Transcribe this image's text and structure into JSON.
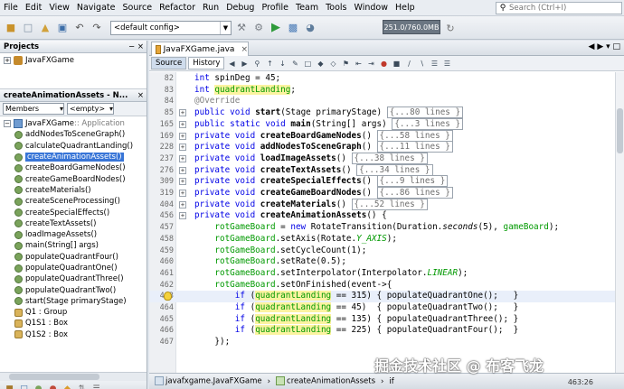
{
  "menu": [
    "File",
    "Edit",
    "View",
    "Navigate",
    "Source",
    "Refactor",
    "Run",
    "Debug",
    "Profile",
    "Team",
    "Tools",
    "Window",
    "Help"
  ],
  "search": {
    "placeholder": "Search (Ctrl+I)"
  },
  "toolbar": {
    "config": "<default config>",
    "memory": "251.0/760.0MB"
  },
  "projects": {
    "title": "Projects",
    "root": "JavaFXGame"
  },
  "navigator": {
    "title": "createAnimationAssets - N...",
    "filter": "Members",
    "filter2": "<empty>",
    "root_name": "JavaFXGame",
    "root_type": " :: Application",
    "items": [
      {
        "name": "addNodesToSceneGraph()",
        "kind": "method"
      },
      {
        "name": "calculateQuadrantLanding()",
        "kind": "method"
      },
      {
        "name": "createAnimationAssets()",
        "kind": "method",
        "selected": true
      },
      {
        "name": "createBoardGameNodes()",
        "kind": "method"
      },
      {
        "name": "createGameBoardNodes()",
        "kind": "method"
      },
      {
        "name": "createMaterials()",
        "kind": "method"
      },
      {
        "name": "createSceneProcessing()",
        "kind": "method"
      },
      {
        "name": "createSpecialEffects()",
        "kind": "method"
      },
      {
        "name": "createTextAssets()",
        "kind": "method"
      },
      {
        "name": "loadImageAssets()",
        "kind": "method"
      },
      {
        "name": "main(String[] args)",
        "kind": "method"
      },
      {
        "name": "populateQuadrantFour()",
        "kind": "method"
      },
      {
        "name": "populateQuadrantOne()",
        "kind": "method"
      },
      {
        "name": "populateQuadrantThree()",
        "kind": "method"
      },
      {
        "name": "populateQuadrantTwo()",
        "kind": "method"
      },
      {
        "name": "start(Stage primaryStage)",
        "kind": "method"
      },
      {
        "name": "Q1 : Group",
        "kind": "field"
      },
      {
        "name": "Q1S1 : Box",
        "kind": "field"
      },
      {
        "name": "Q1S2 : Box",
        "kind": "field"
      }
    ]
  },
  "editor": {
    "tab": "JavaFXGame.java",
    "source_btn": "Source",
    "history_btn": "History"
  },
  "code": [
    {
      "ln": "82",
      "html": "<span class=\"kw\">int</span> spinDeg = 45;"
    },
    {
      "ln": "83",
      "html": "<span class=\"kw\">int</span> <span class=\"hl\">quadrantLanding</span>;"
    },
    {
      "ln": "84",
      "html": "<span class=\"ann\">@Override</span>"
    },
    {
      "ln": "85",
      "fold": true,
      "html": "<span class=\"kw\">public void</span> <span class=\"bold\">start</span>(Stage primaryStage) <span class=\"fold-box\">{...80 lines }</span>"
    },
    {
      "ln": "165",
      "fold": true,
      "html": "<span class=\"kw\">public static void</span> <span class=\"bold\">main</span>(String[] args) <span class=\"fold-box\">{...3 lines }</span>"
    },
    {
      "ln": "169",
      "fold": true,
      "html": "<span class=\"kw\">private void</span> <span class=\"bold\">createBoardGameNodes</span>() <span class=\"fold-box\">{...58 lines }</span>"
    },
    {
      "ln": "228",
      "fold": true,
      "html": "<span class=\"kw\">private void</span> <span class=\"bold\">addNodesToSceneGraph</span>() <span class=\"fold-box\">{...11 lines }</span>"
    },
    {
      "ln": "237",
      "fold": true,
      "html": "<span class=\"kw\">private void</span> <span class=\"bold\">loadImageAssets</span>() <span class=\"fold-box\">{...38 lines }</span>"
    },
    {
      "ln": "276",
      "fold": true,
      "html": "<span class=\"kw\">private void</span> <span class=\"bold\">createTextAssets</span>() <span class=\"fold-box\">{...34 lines }</span>"
    },
    {
      "ln": "309",
      "fold": true,
      "html": "<span class=\"kw\">private void</span> <span class=\"bold\">createSpecialEffects</span>() <span class=\"fold-box\">{...9 lines }</span>"
    },
    {
      "ln": "319",
      "fold": true,
      "html": "<span class=\"kw\">private void</span> <span class=\"bold\">createGameBoardNodes</span>() <span class=\"fold-box\">{...86 lines }</span>"
    },
    {
      "ln": "404",
      "fold": true,
      "html": "<span class=\"kw\">private void</span> <span class=\"bold\">createMaterials</span>() <span class=\"fold-box\">{...52 lines }</span>"
    },
    {
      "ln": "456",
      "fold": true,
      "html": "<span class=\"kw\">private void</span> <span class=\"bold\">createAnimationAssets</span>() {"
    },
    {
      "ln": "457",
      "html": "    <span class=\"fld\">rotGameBoard</span> = <span class=\"kw\">new</span> RotateTransition(Duration.<span class=\"ital\">seconds</span>(5), <span class=\"fld\">gameBoard</span>);"
    },
    {
      "ln": "458",
      "html": "    <span class=\"fld\">rotGameBoard</span>.setAxis(Rotate.<span class=\"ital fld\">Y_AXIS</span>);"
    },
    {
      "ln": "459",
      "html": "    <span class=\"fld\">rotGameBoard</span>.setCycleCount(1);"
    },
    {
      "ln": "460",
      "html": "    <span class=\"fld\">rotGameBoard</span>.setRate(0.5);"
    },
    {
      "ln": "461",
      "html": "    <span class=\"fld\">rotGameBoard</span>.setInterpolator(Interpolator.<span class=\"ital fld\">LINEAR</span>);"
    },
    {
      "ln": "462",
      "html": "    <span class=\"fld\">rotGameBoard</span>.setOnFinished(event-&gt;{"
    },
    {
      "ln": "463",
      "current": true,
      "bulb": true,
      "html": "        <span class=\"kw\">if</span> (<span class=\"hl\">quadrantLanding</span> == 315) { populateQuadrantOne();   }"
    },
    {
      "ln": "464",
      "html": "        <span class=\"kw\">if</span> (<span class=\"hl\">quadrantLanding</span> == 45)  { populateQuadrantTwo();   }"
    },
    {
      "ln": "465",
      "html": "        <span class=\"kw\">if</span> (<span class=\"hl\">quadrantLanding</span> == 135) { populateQuadrantThree(); }"
    },
    {
      "ln": "466",
      "html": "        <span class=\"kw\">if</span> (<span class=\"hl\">quadrantLanding</span> == 225) { populateQuadrantFour();  }"
    },
    {
      "ln": "467",
      "html": "    });"
    }
  ],
  "breadcrumb": [
    "javafxgame.JavaFXGame",
    "createAnimationAssets",
    "if"
  ],
  "status": {
    "position": "463:26"
  },
  "watermark": "掘金技术社区 @ 布客飞龙"
}
